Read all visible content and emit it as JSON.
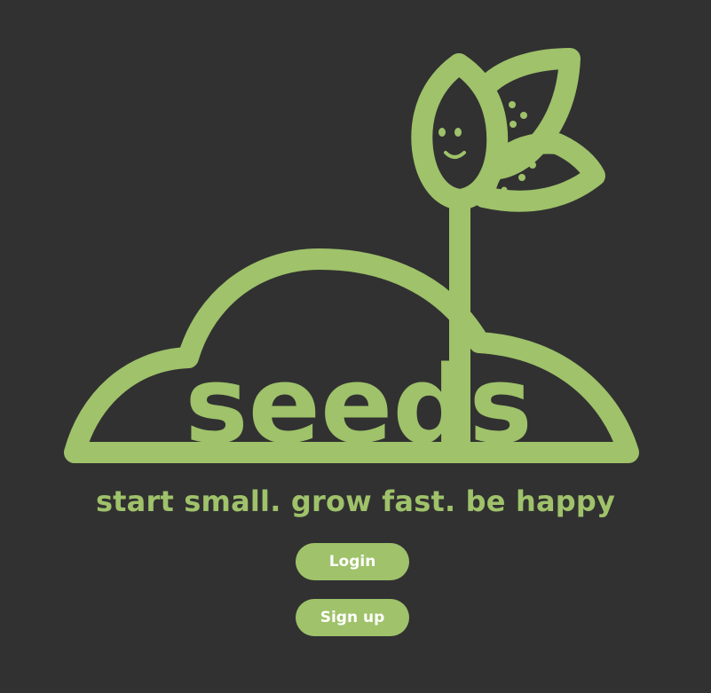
{
  "brand": {
    "logo_word": "seeds",
    "tagline": "start small. grow fast. be happy",
    "color": "#9fc26a",
    "background": "#313131"
  },
  "actions": {
    "login_label": "Login",
    "signup_label": "Sign up"
  },
  "icons": [
    "seedling-icon",
    "smiling-seed-icon",
    "leaf-icon",
    "hill-icon"
  ]
}
